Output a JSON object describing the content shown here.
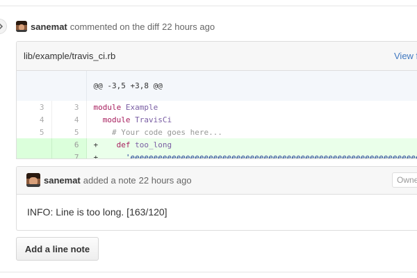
{
  "comment": {
    "author": "sanemat",
    "action": "commented on the diff",
    "time": "22 hours ago"
  },
  "file": {
    "path": "lib/example/travis_ci.rb",
    "view_link": "View f"
  },
  "diff": {
    "hunk_header": "@@ -3,5 +3,8 @@",
    "lines": [
      {
        "old": "3",
        "new": "3",
        "type": "context",
        "tokens": [
          {
            "t": "module",
            "c": "kw"
          },
          {
            "t": " ",
            "c": "pm"
          },
          {
            "t": "Example",
            "c": "ent"
          }
        ]
      },
      {
        "old": "4",
        "new": "4",
        "type": "context",
        "tokens": [
          {
            "t": "  module",
            "c": "kw"
          },
          {
            "t": " ",
            "c": "pm"
          },
          {
            "t": "TravisCi",
            "c": "ent"
          }
        ]
      },
      {
        "old": "5",
        "new": "5",
        "type": "context",
        "tokens": [
          {
            "t": "    # Your code goes here...",
            "c": "cm"
          }
        ]
      },
      {
        "old": "",
        "new": "6",
        "type": "add",
        "tokens": [
          {
            "t": "+",
            "c": "pm"
          },
          {
            "t": "    def",
            "c": "kw"
          },
          {
            "t": " ",
            "c": "pm"
          },
          {
            "t": "too_long",
            "c": "ent"
          }
        ]
      },
      {
        "old": "",
        "new": "7",
        "type": "add",
        "tokens": [
          {
            "t": "+",
            "c": "pm"
          },
          {
            "t": "      'eeeeeeeeeeeeeeeeeeeeeeeeeeeeeeeeeeeeeeeeeeeeeeeeeeeeeeeeeeeeeeeeeeeee",
            "c": "st"
          }
        ]
      }
    ]
  },
  "note": {
    "author": "sanemat",
    "action": "added a note",
    "time": "22 hours ago",
    "badge": "Owne",
    "body": "INFO: Line is too long. [163/120]"
  },
  "add_note_button": "Add a line note",
  "icons": {
    "timeline_toggle": "chevron-right-icon",
    "expand": "unfold-icon"
  }
}
